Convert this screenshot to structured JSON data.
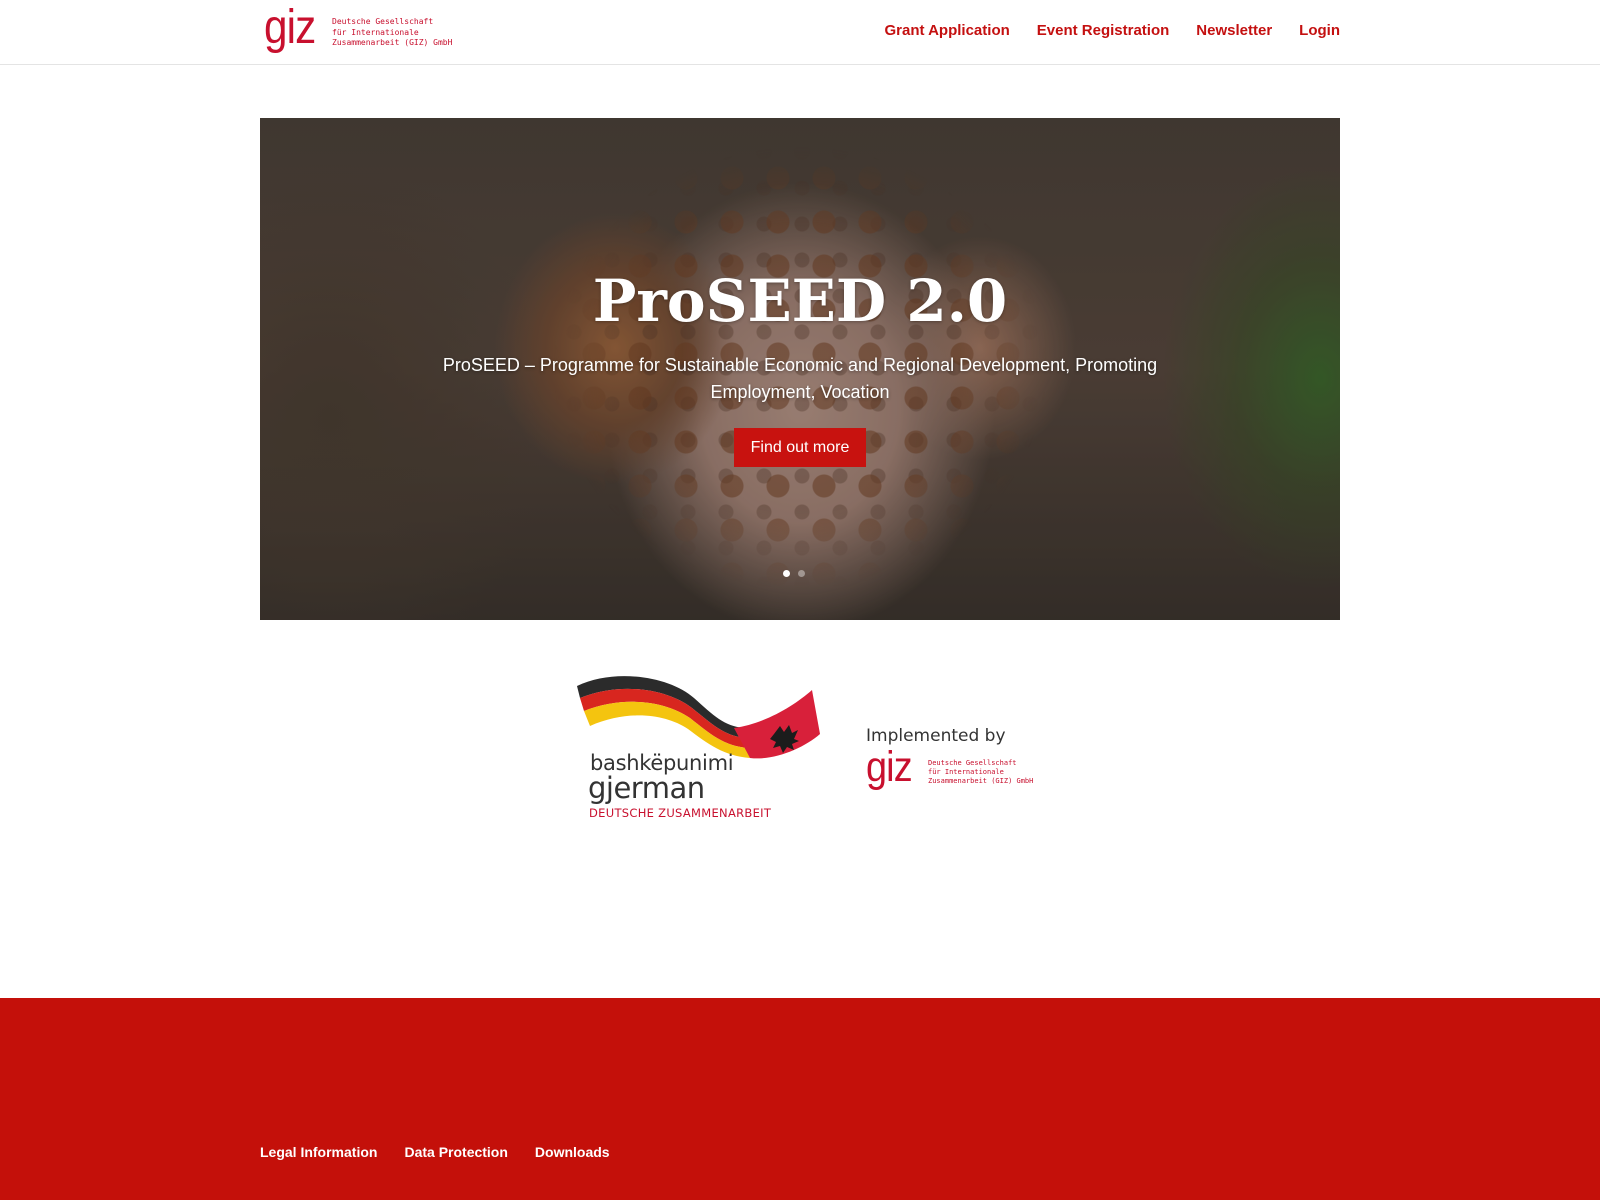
{
  "header": {
    "logo": {
      "mark": "giz",
      "lines": [
        "Deutsche Gesellschaft",
        "für Internationale",
        "Zusammenarbeit (GIZ) GmbH"
      ]
    },
    "nav": [
      {
        "label": "Grant Application"
      },
      {
        "label": "Event Registration"
      },
      {
        "label": "Newsletter"
      },
      {
        "label": "Login"
      }
    ]
  },
  "hero": {
    "title": "ProSEED 2.0",
    "subtitle": "ProSEED – Programme for Sustainable Economic and Regional Development, Promoting Employment, Vocation",
    "button_label": "Find out more",
    "slides_total": 2,
    "active_slide": 1
  },
  "partners": {
    "cooperation": {
      "line1": "bashkëpunimi",
      "line2": "gjerman",
      "line3": "DEUTSCHE ZUSAMMENARBEIT"
    },
    "implemented_by": {
      "label": "Implemented by",
      "mark": "giz",
      "lines": [
        "Deutsche Gesellschaft",
        "für Internationale",
        "Zusammenarbeit (GIZ) GmbH"
      ]
    }
  },
  "footer": {
    "nav": [
      {
        "label": "Legal Information"
      },
      {
        "label": "Data Protection"
      },
      {
        "label": "Downloads"
      }
    ]
  },
  "colors": {
    "brand_red": "#c8102e",
    "footer_red": "#c4100a",
    "button_red": "#c8120f"
  }
}
